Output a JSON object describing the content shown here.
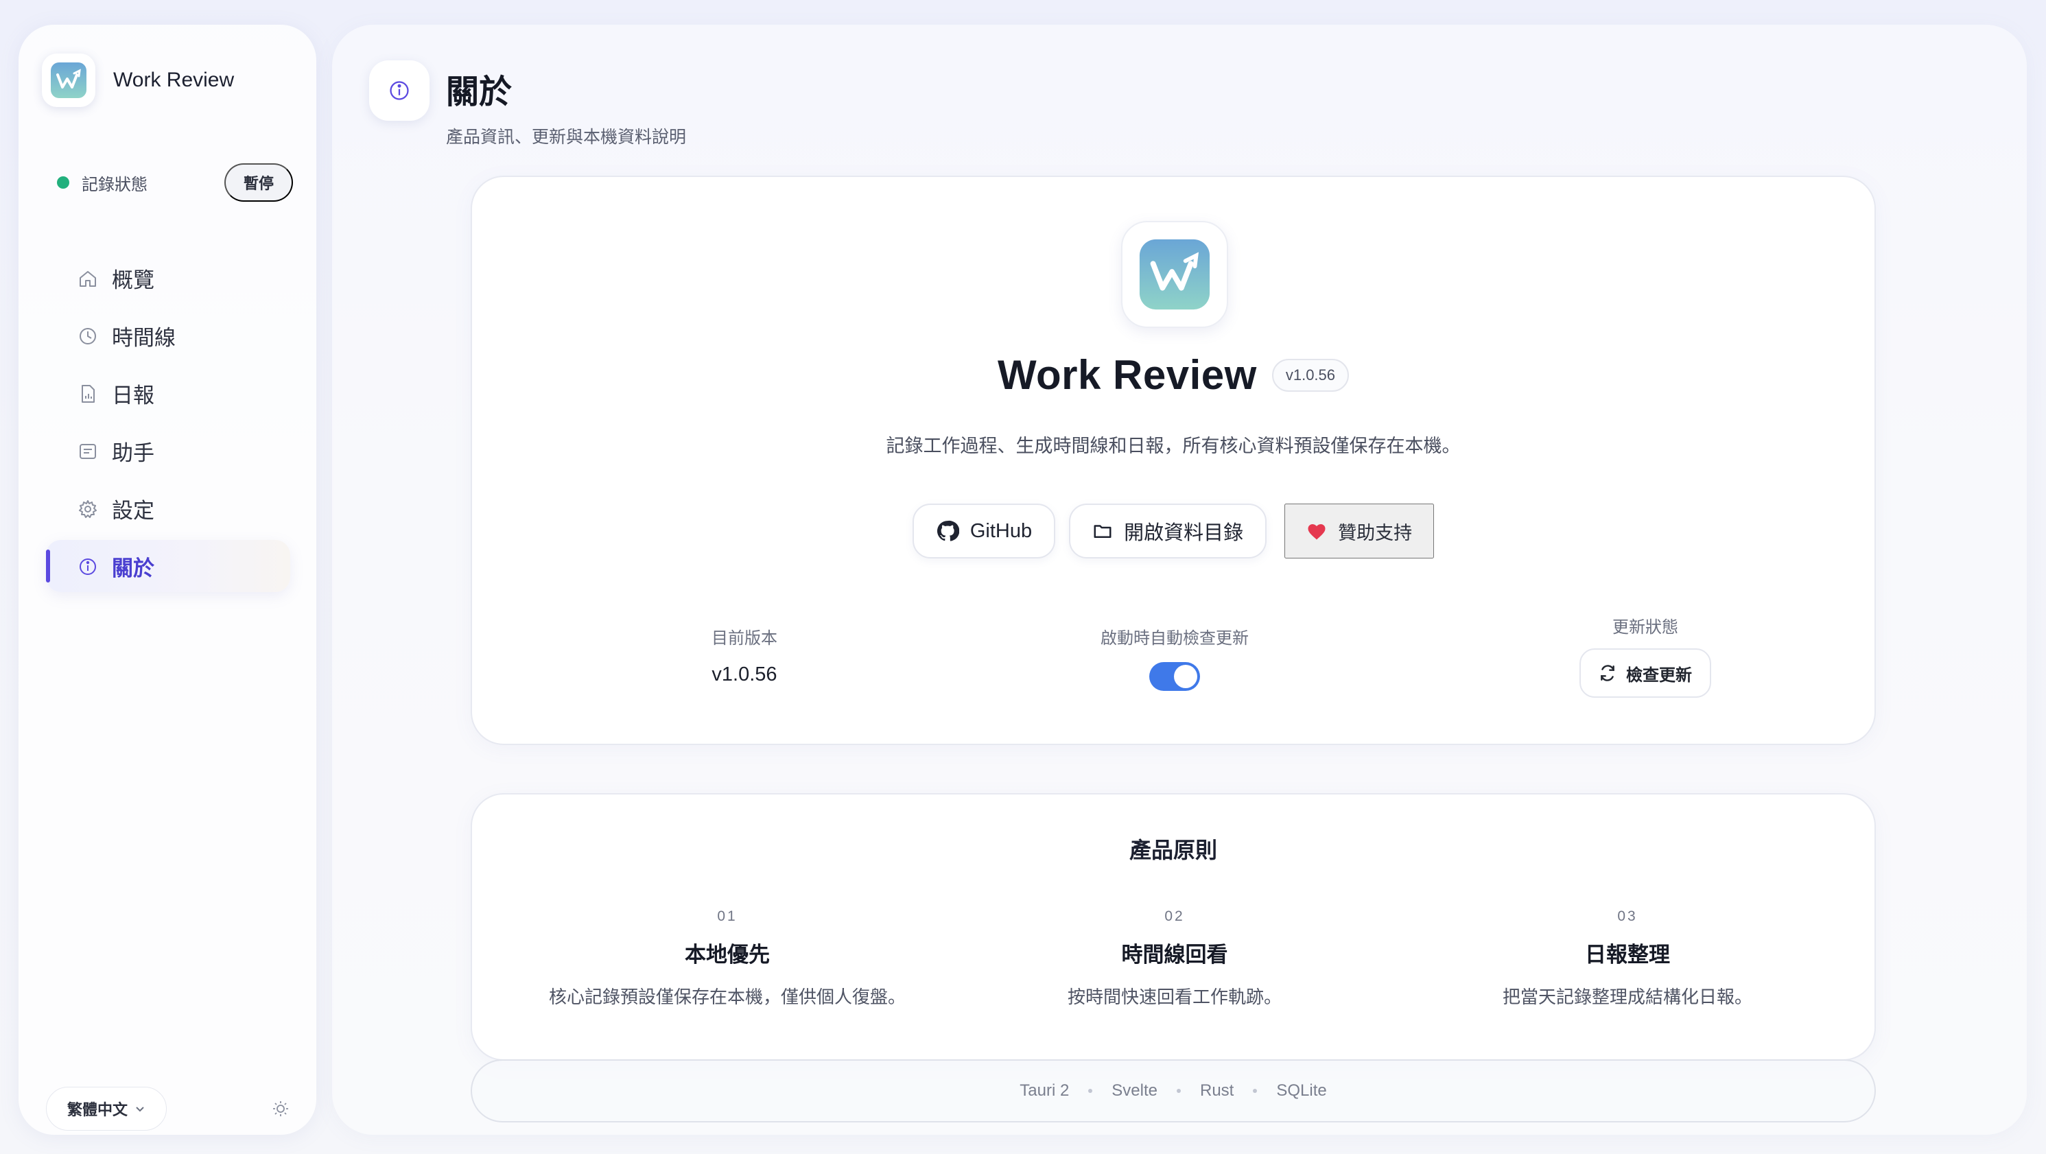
{
  "app": {
    "name": "Work Review",
    "version": "v1.0.56",
    "description": "記錄工作過程、生成時間線和日報，所有核心資料預設僅保存在本機。"
  },
  "sidebar": {
    "status_label": "記錄狀態",
    "pause_label": "暫停",
    "items": [
      {
        "label": "概覽",
        "icon": "home-icon"
      },
      {
        "label": "時間線",
        "icon": "clock-icon"
      },
      {
        "label": "日報",
        "icon": "report-icon"
      },
      {
        "label": "助手",
        "icon": "assistant-icon"
      },
      {
        "label": "設定",
        "icon": "gear-icon"
      },
      {
        "label": "關於",
        "icon": "info-icon",
        "active": true
      }
    ],
    "language": "繁體中文"
  },
  "header": {
    "title": "關於",
    "subtitle": "產品資訊、更新與本機資料說明"
  },
  "actions": {
    "github": "GitHub",
    "open_data_dir": "開啟資料目錄",
    "sponsor": "贊助支持"
  },
  "info": {
    "current_version_label": "目前版本",
    "current_version_value": "v1.0.56",
    "auto_check_label": "啟動時自動檢查更新",
    "auto_check_enabled": true,
    "update_status_label": "更新狀態",
    "check_update_button": "檢查更新"
  },
  "principles": {
    "title": "產品原則",
    "items": [
      {
        "num": "01",
        "title": "本地優先",
        "desc": "核心記錄預設僅保存在本機，僅供個人復盤。"
      },
      {
        "num": "02",
        "title": "時間線回看",
        "desc": "按時間快速回看工作軌跡。"
      },
      {
        "num": "03",
        "title": "日報整理",
        "desc": "把當天記錄整理成結構化日報。"
      }
    ]
  },
  "tech_stack": [
    "Tauri 2",
    "Svelte",
    "Rust",
    "SQLite"
  ],
  "colors": {
    "accent": "#5b49e0",
    "status_green": "#22b07d",
    "toggle_blue": "#3f79e9",
    "heart_red": "#e5384f"
  }
}
